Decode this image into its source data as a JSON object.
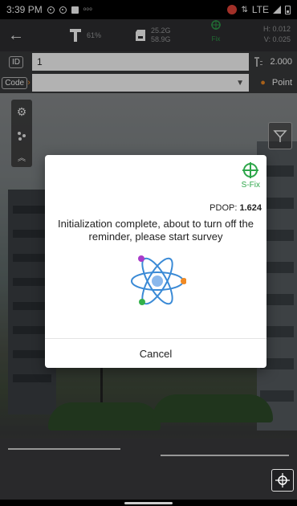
{
  "status_bar": {
    "time": "3:39 PM",
    "mini_text": "ooo",
    "network": "LTE"
  },
  "app_bar": {
    "battery": "61%",
    "storage_used": "25.2G",
    "storage_total": "58.9G",
    "fix_short": "Fix",
    "h_precision": "H: 0.012",
    "v_precision": "V: 0.025"
  },
  "id_row": {
    "label": "ID",
    "value": "1",
    "antenna_height": "2.000"
  },
  "code_row": {
    "label": "Code",
    "value": "",
    "point_label": "Point"
  },
  "dialog": {
    "fix_status": "S-Fix",
    "pdop_label": "PDOP:",
    "pdop_value": "1.624",
    "message": "Initialization complete, about to turn off the reminder, please start survey",
    "cancel_label": "Cancel"
  },
  "colors": {
    "fix_green": "#2ea64a",
    "accent_orange": "#f08a24",
    "atom_blue": "#3a8ad6"
  }
}
